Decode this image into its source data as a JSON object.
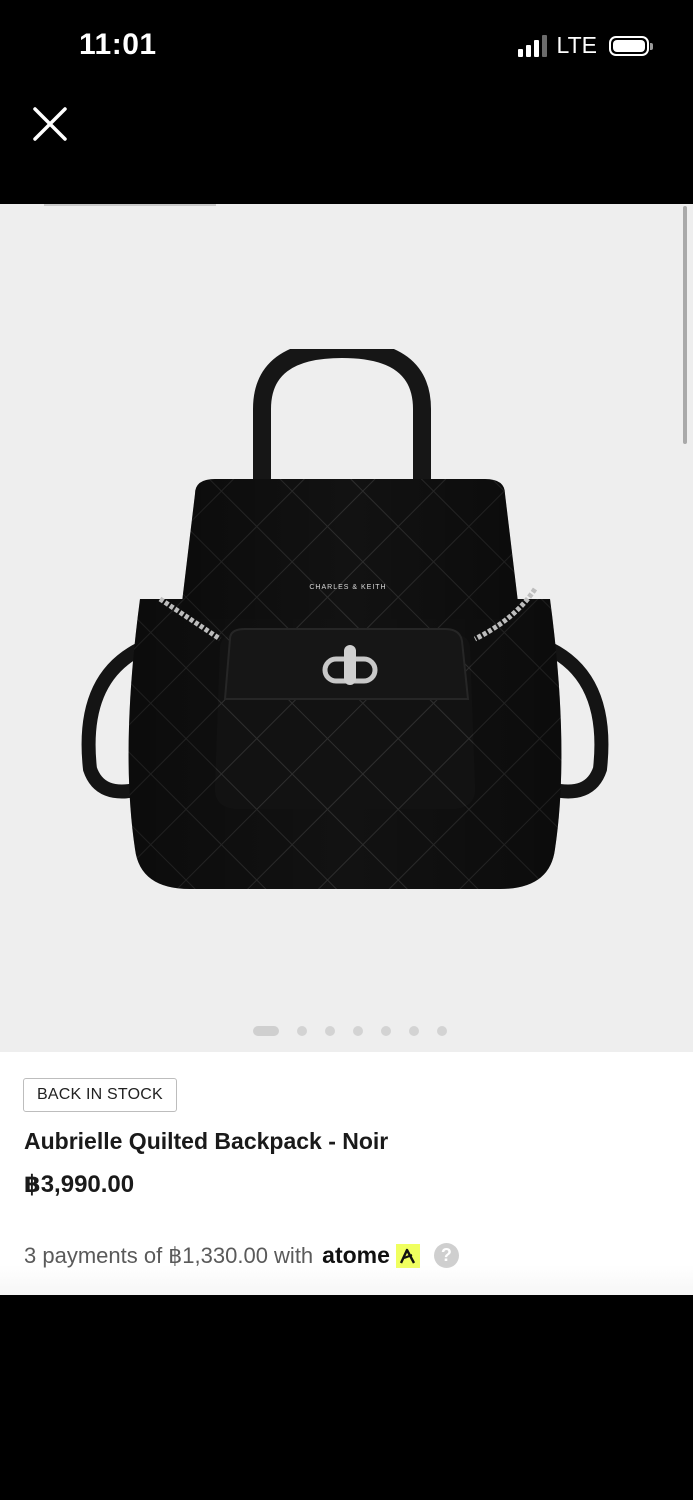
{
  "status_bar": {
    "time": "11:01",
    "network": "LTE",
    "signal_bars": 4,
    "signal_bars_active": 3
  },
  "nav": {
    "close_icon": "close-icon"
  },
  "gallery": {
    "image_count": 7,
    "active_index": 0,
    "image_alt": "Aubrielle Quilted Backpack - Noir",
    "brand_mark": "CHARLES & KEITH"
  },
  "product": {
    "badge": "BACK IN STOCK",
    "name": "Aubrielle Quilted Backpack - Noir",
    "price": "฿3,990.00",
    "installment_text": "3 payments of ฿1,330.00 with",
    "installment_provider": "atome",
    "help_icon": "?"
  },
  "colors": {
    "gallery_bg": "#eeeeee",
    "atome_yellow": "#f0ff5f",
    "bag": "#111111"
  }
}
